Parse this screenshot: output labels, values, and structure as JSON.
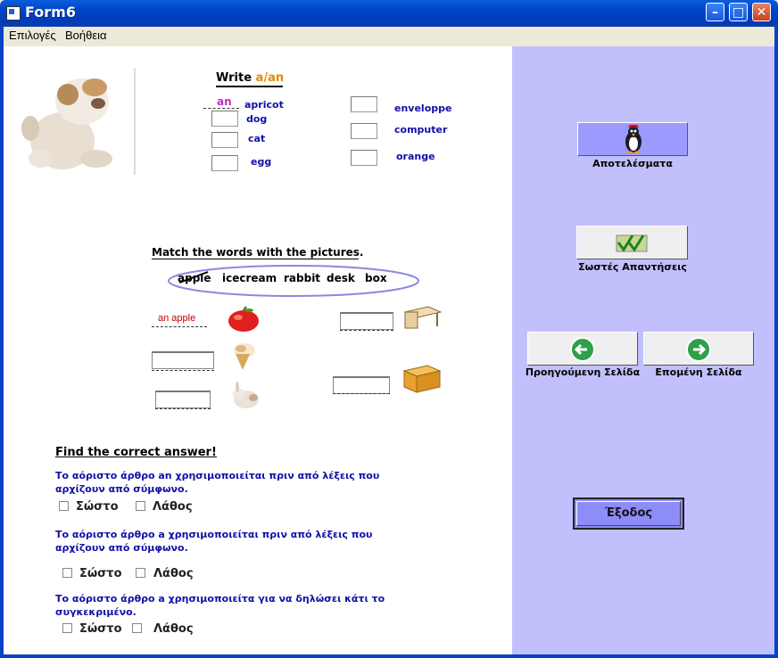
{
  "window": {
    "title": "Form6"
  },
  "menu": [
    "Επιλογές",
    "Βοήθεια"
  ],
  "section_a_an": {
    "title_prefix": "Write ",
    "title_highlight": "a/an",
    "left_items": [
      {
        "answer": "an",
        "word": "apricot"
      },
      {
        "answer": "",
        "word": "dog"
      },
      {
        "answer": "",
        "word": "cat"
      },
      {
        "answer": "",
        "word": "egg"
      }
    ],
    "right_items": [
      {
        "answer": "",
        "word": "enveloppe"
      },
      {
        "answer": "",
        "word": "computer"
      },
      {
        "answer": "",
        "word": "orange"
      }
    ]
  },
  "section_match": {
    "title": "Match the words with the pictures.",
    "words": [
      "apple",
      "icecream",
      "rabbit",
      "desk",
      "box"
    ],
    "crossed_word": "apple",
    "entries": [
      {
        "answer": "an apple",
        "picture": "apple"
      },
      {
        "answer": "",
        "picture": "icecream"
      },
      {
        "answer": "",
        "picture": "rabbit"
      },
      {
        "answer": "",
        "picture": "desk"
      },
      {
        "answer": "",
        "picture": "box"
      }
    ]
  },
  "section_find": {
    "title": "Find the correct answer!",
    "questions": [
      {
        "text": "Το αόριστο άρθρο an  χρησιμοποιείται πριν από λέξεις που αρχίζουν από σύμφωνο.",
        "options": [
          "Σώστο",
          "Λάθος"
        ]
      },
      {
        "text": "Το αόριστο άρθρο a χρησιμοποιείται πριν από λέξεις που αρχίζουν από σύμφωνο.",
        "options": [
          "Σώστο",
          "Λάθος"
        ]
      },
      {
        "text": "Το αόριστο άρθρο a χρησιμοποιείτα για να δηλώσει κάτι το συγκεκριμένο.",
        "options": [
          "Σώστο",
          "Λάθος"
        ]
      }
    ]
  },
  "buttons": {
    "results": "Αποτελέσματα",
    "answers": "Σωστές Απαντήσεις",
    "prev": "Προηγούμενη Σελίδα",
    "next": "Επομένη Σελίδα",
    "exit": "Έξοδος"
  },
  "colors": {
    "title_bar": "#0043c8",
    "right_panel": "#c1c0fd",
    "label_blue": "#1010a8",
    "highlight_orange": "#e08a00",
    "answer_magenta": "#c030c0"
  }
}
